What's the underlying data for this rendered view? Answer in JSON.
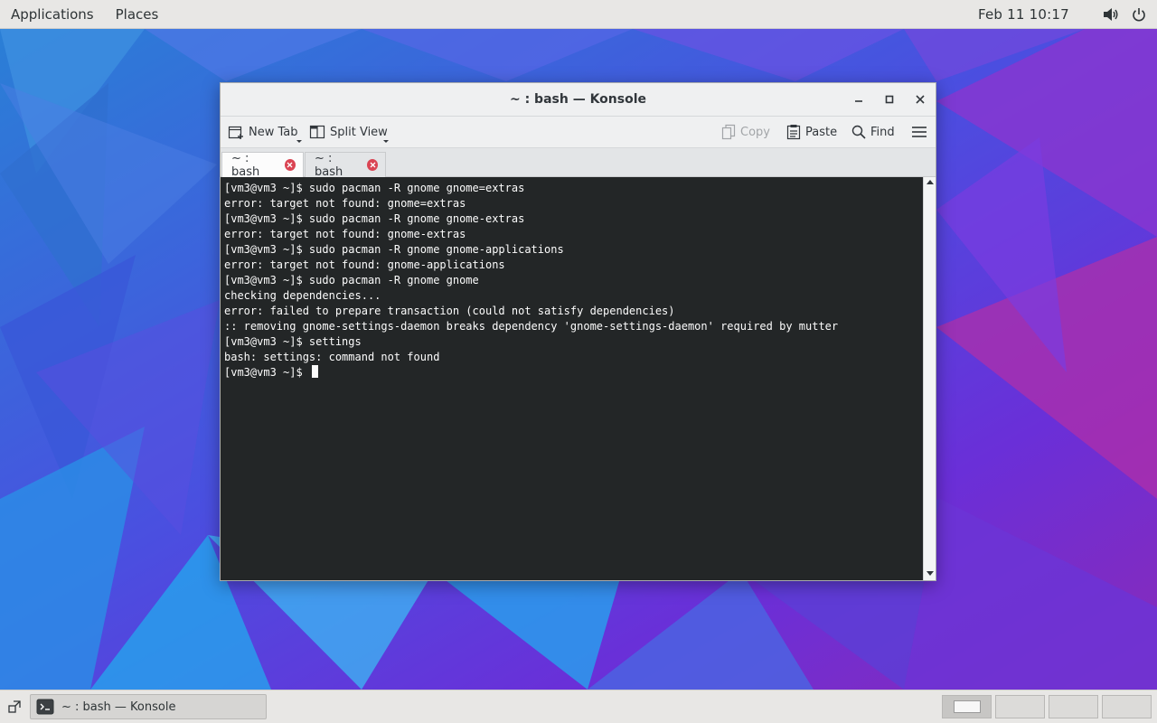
{
  "top_bar": {
    "menus": [
      "Applications",
      "Places"
    ],
    "clock": "Feb 11  10:17",
    "tray_icons": [
      "volume-icon",
      "power-icon"
    ]
  },
  "window": {
    "title": "~ : bash — Konsole",
    "controls": [
      "minimize-icon",
      "maximize-icon",
      "close-icon"
    ],
    "toolbar": {
      "new_tab": "New Tab",
      "split_view": "Split View",
      "copy": "Copy",
      "paste": "Paste",
      "find": "Find",
      "menu_icon": "hamburger-menu-icon"
    },
    "tabs": [
      {
        "label": "~ : bash",
        "active": true
      },
      {
        "label": "~ : bash",
        "active": false
      }
    ],
    "terminal": {
      "lines": [
        "[vm3@vm3 ~]$ sudo pacman -R gnome gnome=extras",
        "error: target not found: gnome=extras",
        "[vm3@vm3 ~]$ sudo pacman -R gnome gnome-extras",
        "error: target not found: gnome-extras",
        "[vm3@vm3 ~]$ sudo pacman -R gnome gnome-applications",
        "error: target not found: gnome-applications",
        "[vm3@vm3 ~]$ sudo pacman -R gnome gnome",
        "checking dependencies...",
        "error: failed to prepare transaction (could not satisfy dependencies)",
        ":: removing gnome-settings-daemon breaks dependency 'gnome-settings-daemon' required by mutter",
        "[vm3@vm3 ~]$ settings",
        "bash: settings: command not found"
      ],
      "prompt": "[vm3@vm3 ~]$ "
    }
  },
  "bottom_bar": {
    "task_label": "~ : bash — Konsole",
    "workspaces": 4,
    "active_workspace": 1
  },
  "colors": {
    "terminal_bg": "#232627",
    "terminal_fg": "#fcfcfc",
    "tab_close": "#da4453",
    "panel_bg": "#e8e7e5"
  }
}
